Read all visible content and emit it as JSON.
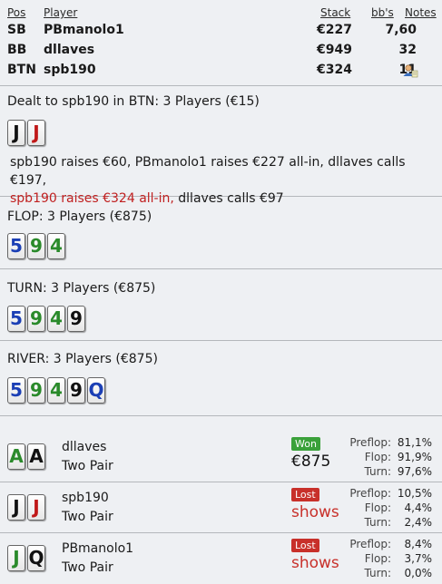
{
  "players_header": {
    "pos": "Pos",
    "player": "Player",
    "stack": "Stack",
    "bbs": "bb's",
    "notes": "Notes"
  },
  "players": [
    {
      "pos": "SB",
      "name": "PBmanolo1",
      "stack": "€227",
      "bbs": "7,60"
    },
    {
      "pos": "BB",
      "name": "dllaves",
      "stack": "€949",
      "bbs": "32"
    },
    {
      "pos": "BTN",
      "name": "spb190",
      "stack": "€324",
      "bbs": "11",
      "note_icon": "user-note-icon"
    }
  ],
  "preflop": {
    "title": "Dealt to spb190 in BTN: 3 Players (€15)",
    "cards": [
      {
        "rank": "J",
        "color": "#111111"
      },
      {
        "rank": "J",
        "color": "#c01818"
      }
    ],
    "actions_line1": "spb190 raises €60, PBmanolo1 raises €227 all-in, dllaves calls €197,",
    "actions_line2_red": "spb190 raises €324 all-in,",
    "actions_line2_rest": " dllaves calls €97"
  },
  "flop": {
    "title": "FLOP: 3 Players (€875)",
    "cards": [
      {
        "rank": "5",
        "color": "#1b3fb5"
      },
      {
        "rank": "9",
        "color": "#2a8a2a"
      },
      {
        "rank": "4",
        "color": "#2a8a2a"
      }
    ]
  },
  "turn": {
    "title": "TURN: 3 Players (€875)",
    "cards": [
      {
        "rank": "5",
        "color": "#1b3fb5"
      },
      {
        "rank": "9",
        "color": "#2a8a2a"
      },
      {
        "rank": "4",
        "color": "#2a8a2a"
      },
      {
        "rank": "9",
        "color": "#111111"
      }
    ]
  },
  "river": {
    "title": "RIVER: 3 Players (€875)",
    "cards": [
      {
        "rank": "5",
        "color": "#1b3fb5"
      },
      {
        "rank": "9",
        "color": "#2a8a2a"
      },
      {
        "rank": "4",
        "color": "#2a8a2a"
      },
      {
        "rank": "9",
        "color": "#111111"
      },
      {
        "rank": "Q",
        "color": "#1b3fb5"
      }
    ]
  },
  "equity_labels": {
    "preflop": "Preflop:",
    "flop": "Flop:",
    "turn": "Turn:"
  },
  "results": [
    {
      "name": "dllaves",
      "hand": "Two Pair",
      "cards": [
        {
          "rank": "A",
          "color": "#2a8a2a"
        },
        {
          "rank": "A",
          "color": "#111111"
        }
      ],
      "status": "Won",
      "status_kind": "won",
      "amount": "€875",
      "preflop": "81,1%",
      "flop": "91,9%",
      "turn": "97,6%"
    },
    {
      "name": "spb190",
      "hand": "Two Pair",
      "cards": [
        {
          "rank": "J",
          "color": "#111111"
        },
        {
          "rank": "J",
          "color": "#c01818"
        }
      ],
      "status": "Lost",
      "status_kind": "lost",
      "amount": "shows",
      "preflop": "10,5%",
      "flop": "4,4%",
      "turn": "2,4%"
    },
    {
      "name": "PBmanolo1",
      "hand": "Two Pair",
      "cards": [
        {
          "rank": "J",
          "color": "#2a8a2a"
        },
        {
          "rank": "Q",
          "color": "#111111"
        }
      ],
      "status": "Lost",
      "status_kind": "lost",
      "amount": "shows",
      "preflop": "8,4%",
      "flop": "3,7%",
      "turn": "0,0%"
    }
  ]
}
